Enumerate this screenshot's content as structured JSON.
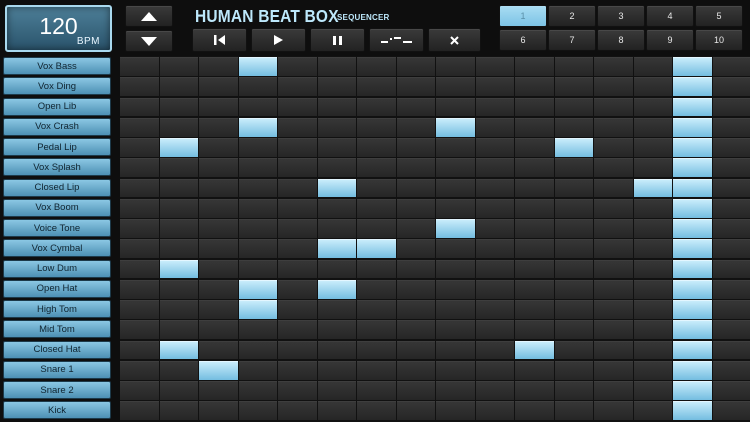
{
  "bpm": {
    "value": "120",
    "unit": "BPM"
  },
  "header": {
    "title": "HUMAN BEAT BOX",
    "subtitle": "SEQUENCER"
  },
  "controls": {
    "tempo_up_icon": "triangle-up",
    "tempo_down_icon": "triangle-down",
    "rewind_icon": "rewind",
    "play_icon": "play",
    "pause_icon": "pause",
    "shuffle_icon": "shuffle-pattern",
    "clear_icon": "close"
  },
  "patterns": {
    "labels": [
      "1",
      "2",
      "3",
      "4",
      "5",
      "6",
      "7",
      "8",
      "9",
      "10"
    ],
    "active_index": 0
  },
  "tracks": [
    "Vox Bass",
    "Vox Ding",
    "Open Lib",
    "Vox Crash",
    "Pedal Lip",
    "Vox Splash",
    "Closed Lip",
    "Vox Boom",
    "Voice Tone",
    "Vox Cymbal",
    "Low Dum",
    "Open Hat",
    "High Tom",
    "Mid Tom",
    "Closed Hat",
    "Snare 1",
    "Snare 2",
    "Kick"
  ],
  "steps": 16,
  "playhead_step": 14,
  "active_steps": [
    [
      3
    ],
    [],
    [],
    [
      3,
      8
    ],
    [
      1,
      11
    ],
    [],
    [
      5,
      13
    ],
    [],
    [
      8
    ],
    [
      5,
      6
    ],
    [
      1
    ],
    [
      3,
      5
    ],
    [
      3
    ],
    [],
    [
      1,
      10
    ],
    [
      2
    ],
    [],
    []
  ],
  "colors": {
    "accent": "#8fd3f0",
    "label_bg": "#6aaed0",
    "cell_off": "#2d2d2d"
  }
}
